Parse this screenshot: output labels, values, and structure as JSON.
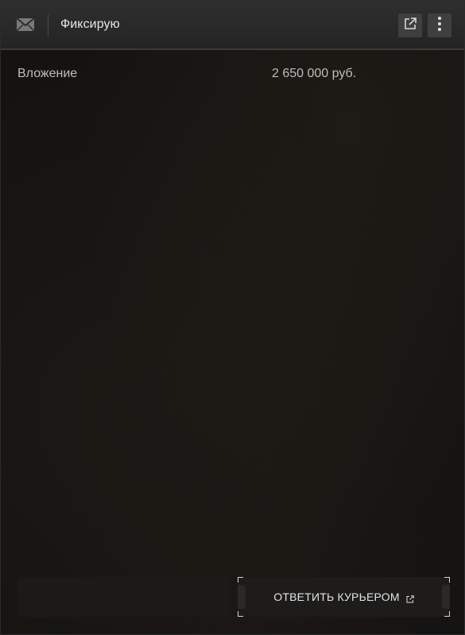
{
  "header": {
    "title": "Фиксирую",
    "icon": "mail-icon",
    "actions": [
      {
        "icon": "external-link-icon"
      },
      {
        "icon": "more-vertical-icon"
      }
    ]
  },
  "details": {
    "label": "Вложение",
    "value": "2 650 000 руб."
  },
  "footer": {
    "reply_label": "ОТВЕТИТЬ КУРЬЕРОМ",
    "reply_icon": "external-link-icon"
  },
  "colors": {
    "background": "#151311",
    "header": "#2a2a2a",
    "text": "#e6e6e6",
    "muted_text": "#bdbdbd"
  }
}
